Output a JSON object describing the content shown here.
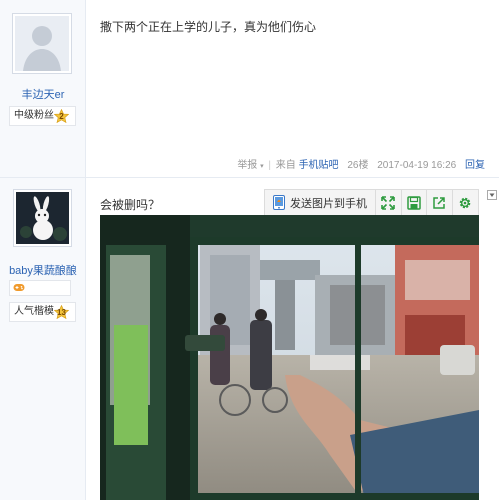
{
  "post1": {
    "user": {
      "name": "丰边天er",
      "level_title": "中级粉丝",
      "level_number": "2"
    },
    "content": "撒下两个正在上学的儿子，真为他们伤心",
    "tail": {
      "report": "举报",
      "source_prefix": "来自",
      "source_link": "手机贴吧",
      "floor": "26楼",
      "time": "2017-04-19 16:26",
      "reply": "回复"
    }
  },
  "post2": {
    "user": {
      "name": "baby果蔬酿酿",
      "level_title": "人气楷模",
      "level_number": "13"
    },
    "content": "会被删吗？",
    "toolbar": {
      "send_label": "发送图片到手机"
    }
  },
  "icons": {
    "phone": "phone-send-icon",
    "expand": "expand-icon",
    "save": "save-icon",
    "share": "share-icon",
    "settings": "gear-icon"
  },
  "colors": {
    "link": "#2d64b3",
    "toolbar_green": "#2e9b3f",
    "badge_gold": "#f3c43c"
  }
}
